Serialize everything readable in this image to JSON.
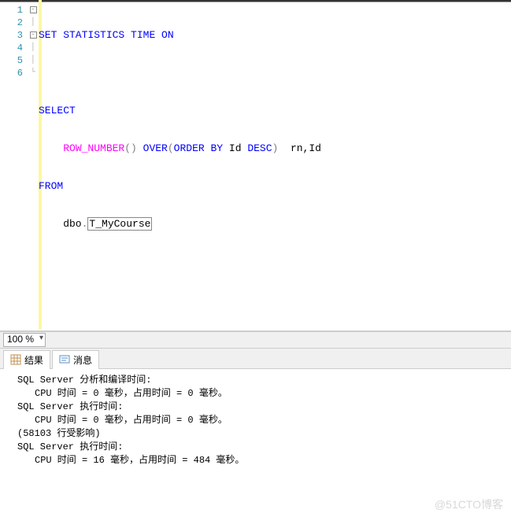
{
  "editor": {
    "lineNumbers": [
      "1",
      "2",
      "3",
      "4",
      "5",
      "6"
    ],
    "tokens": {
      "l1_set": "SET",
      "l1_stat": " STATISTICS",
      "l1_time": " TIME",
      "l1_on": " ON",
      "l3_select": "SELECT",
      "l4_rownum": "ROW_NUMBER",
      "l4_paren": "()",
      "l4_over": " OVER",
      "l4_open": "(",
      "l4_order": "ORDER",
      "l4_by": " BY",
      "l4_id": " Id ",
      "l4_desc": "DESC",
      "l4_close": ")",
      "l4_tail": "  rn,Id",
      "l5_from": "FROM",
      "l6_dbo": "    dbo",
      "l6_dot": ".",
      "l6_table": "T_MyCourse"
    }
  },
  "zoom": {
    "value": "100 %"
  },
  "tabs": {
    "results": "结果",
    "messages": "消息"
  },
  "results": {
    "line1": "SQL Server 分析和编译时间:",
    "line2": "CPU 时间 = 0 毫秒，占用时间 = 0 毫秒。",
    "blank1": " ",
    "line3": "SQL Server 执行时间:",
    "line4": "CPU 时间 = 0 毫秒，占用时间 = 0 毫秒。",
    "blank2": " ",
    "line5": "(58103 行受影响)",
    "blank3": " ",
    "line6": "SQL Server 执行时间:",
    "line7": "CPU 时间 = 16 毫秒，占用时间 = 484 毫秒。"
  },
  "watermark": "@51CTO博客"
}
